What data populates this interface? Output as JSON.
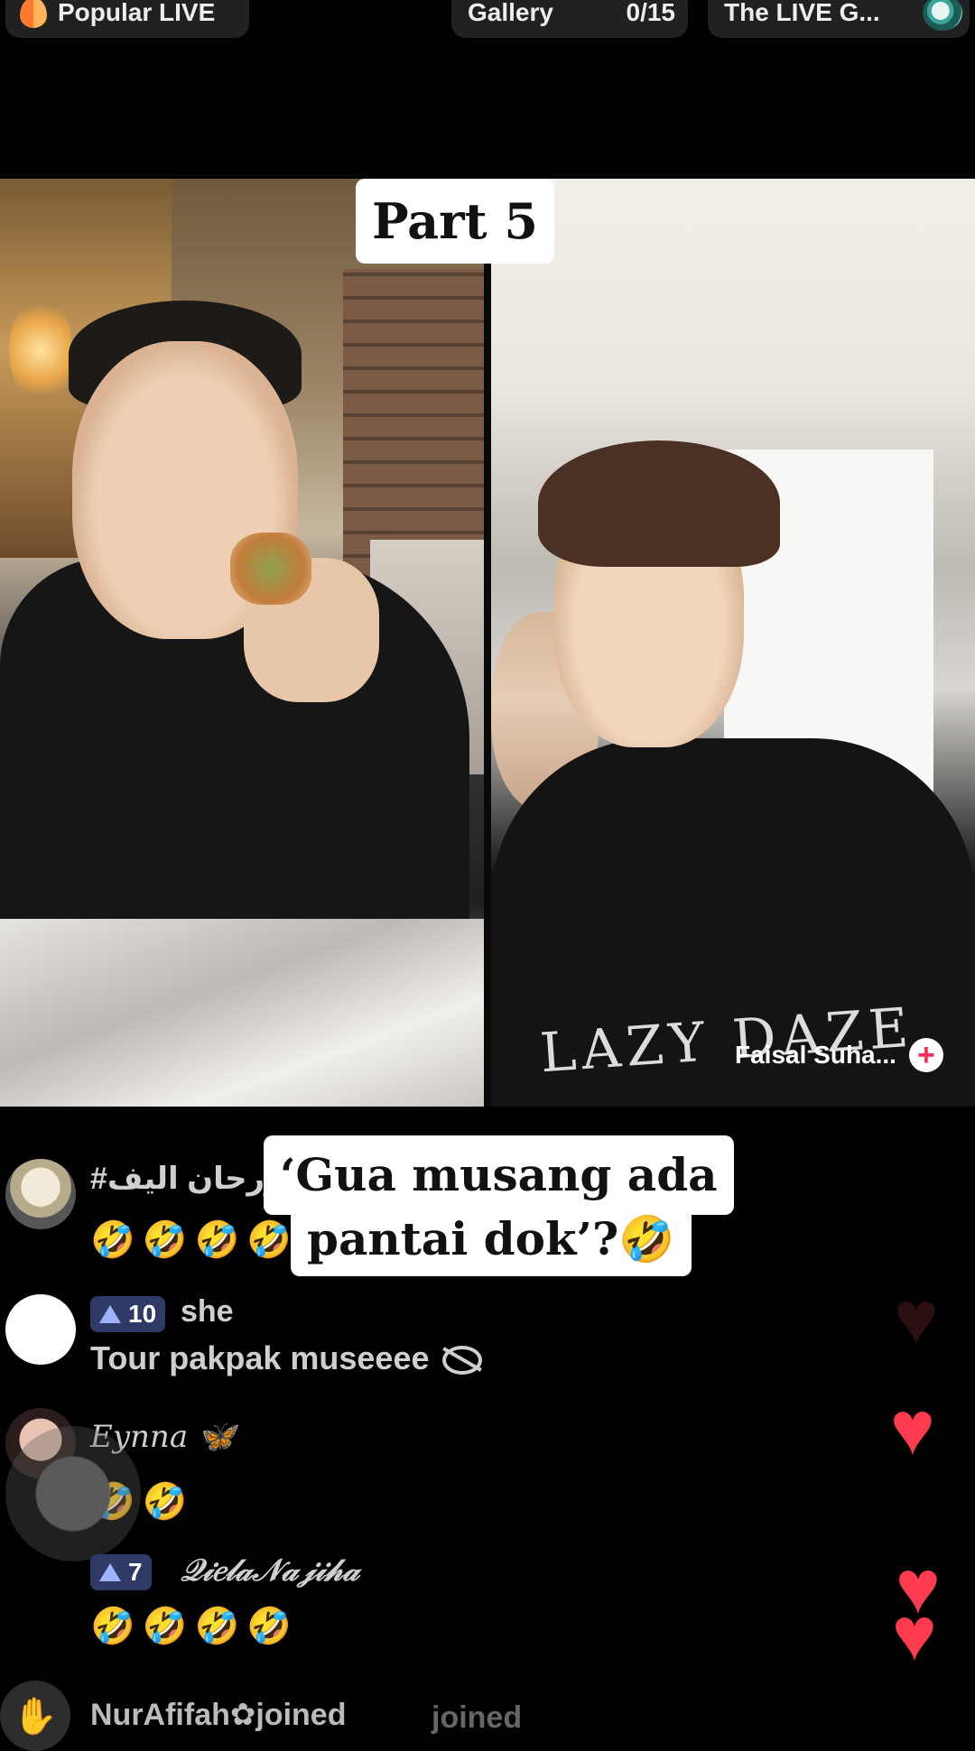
{
  "top_bar": {
    "popular_label": "Popular LIVE",
    "gallery_label": "Gallery",
    "gallery_count": "0/15",
    "game_label": "The LIVE G..."
  },
  "captions": {
    "part": "Part 5",
    "quote_line1": "‘Gua musang ada",
    "quote_line2": "pantai dok’?🤣"
  },
  "right_stream": {
    "shirt_text": "LAZY DAZE",
    "host_name": "Faisal Suha...",
    "add_icon": "+"
  },
  "comments": [
    {
      "username": "#ورحان اليف",
      "message": "🤣🤣🤣🤣"
    },
    {
      "badge_level": "10",
      "username": "she",
      "message": "Tour pakpak museeee"
    },
    {
      "username": "𝐸𝑦𝑛𝑛𝑎 🦋",
      "message": "🤣🤣"
    },
    {
      "badge_level": "7",
      "username": "𝒬𝒾𝑒𝓁𝒶𝒩𝒶𝒿𝒾𝒽𝒶",
      "message": "🤣🤣🤣🤣"
    }
  ],
  "join_notice": {
    "text": "NurAfifah✿joined",
    "ghost_text": "joined"
  },
  "colors": {
    "like_heart": "#ff3b4f",
    "badge_bg": "#2f3b66",
    "follow_plus": "#fe2c55"
  }
}
